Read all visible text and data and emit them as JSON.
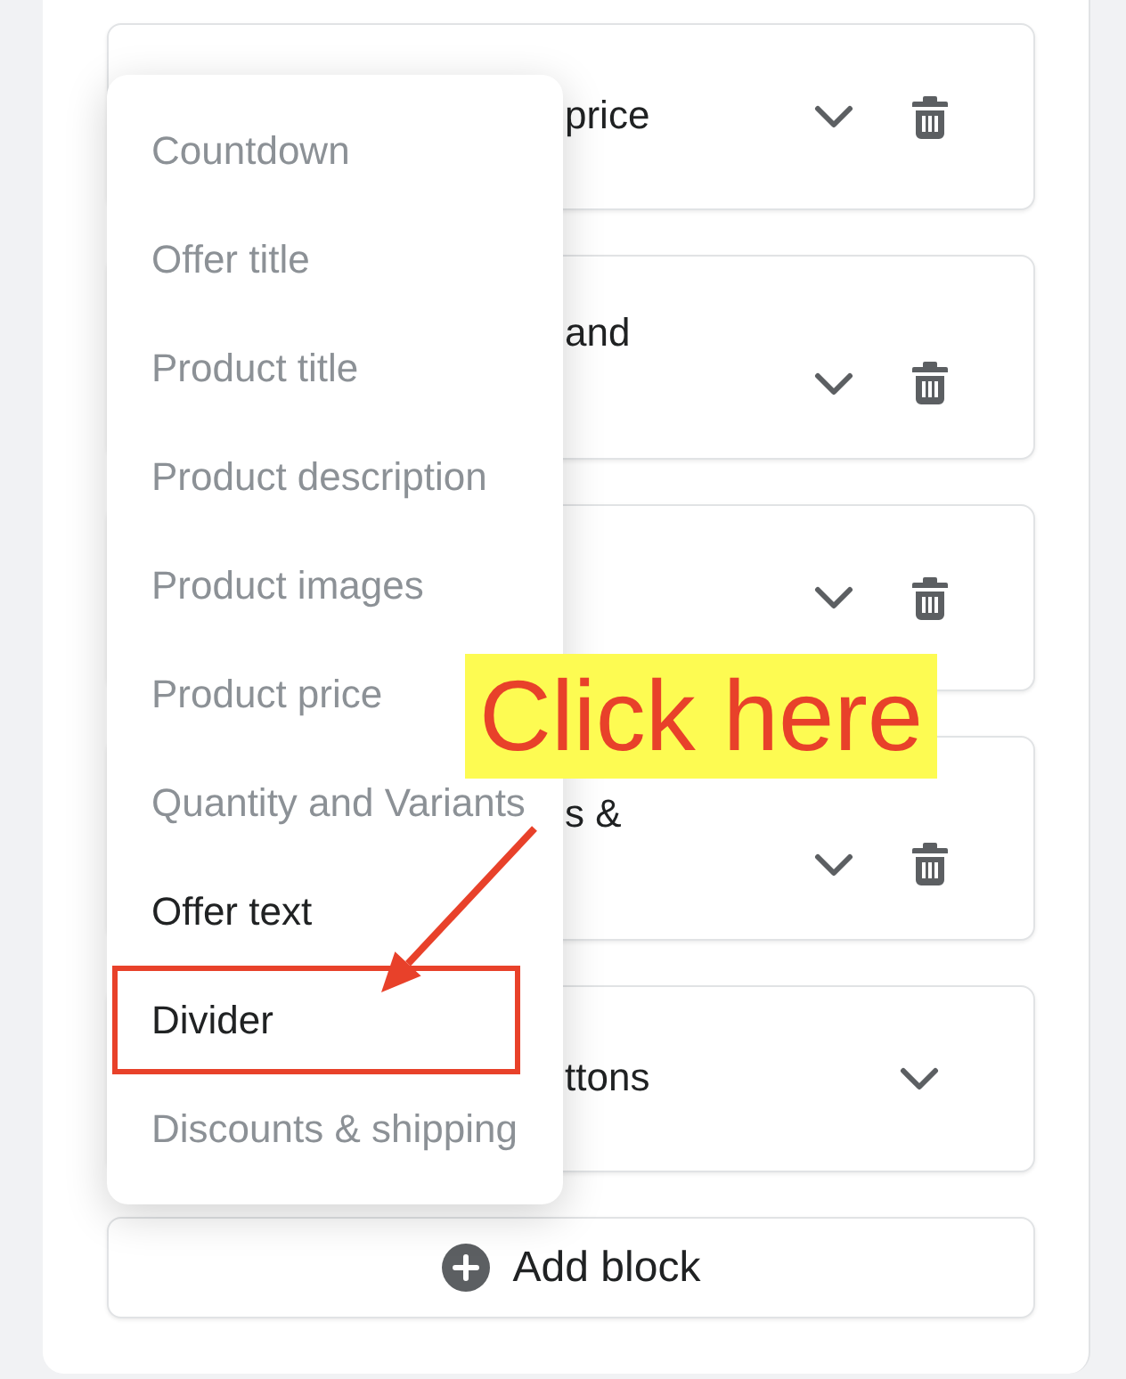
{
  "blocks": [
    {
      "title": "price",
      "wrapped": false,
      "removable": true
    },
    {
      "title": "and",
      "wrapped": true,
      "removable": true
    },
    {
      "wrapped": false,
      "removable": true
    },
    {
      "title": "s &",
      "wrapped": true,
      "removable": true
    },
    {
      "title": "ttons",
      "wrapped": false,
      "removable": false
    }
  ],
  "add_button": {
    "label": "Add block"
  },
  "menu": {
    "items": [
      {
        "label": "Countdown",
        "disabled": true,
        "highlighted": false
      },
      {
        "label": "Offer title",
        "disabled": true,
        "highlighted": false
      },
      {
        "label": "Product title",
        "disabled": true,
        "highlighted": false
      },
      {
        "label": "Product description",
        "disabled": true,
        "highlighted": false
      },
      {
        "label": "Product images",
        "disabled": true,
        "highlighted": false
      },
      {
        "label": "Product price",
        "disabled": true,
        "highlighted": false
      },
      {
        "label": "Quantity and Variants",
        "disabled": true,
        "highlighted": false
      },
      {
        "label": "Offer text",
        "disabled": false,
        "highlighted": false
      },
      {
        "label": "Divider",
        "disabled": false,
        "highlighted": true
      },
      {
        "label": "Discounts & shipping",
        "disabled": true,
        "highlighted": false
      }
    ]
  },
  "annotation": {
    "label": "Click here"
  }
}
